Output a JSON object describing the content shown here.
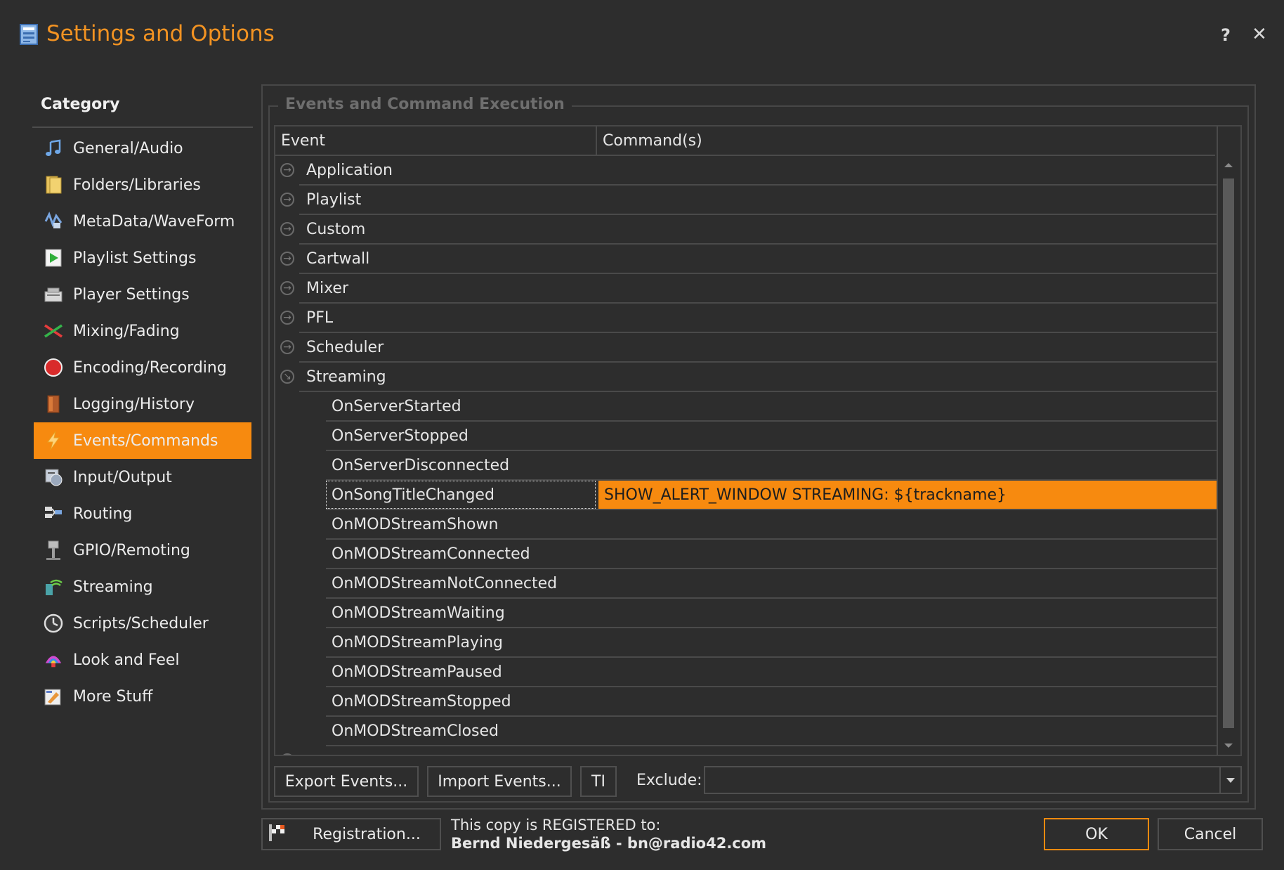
{
  "window": {
    "title": "Settings and Options",
    "help_label": "?",
    "close_label": "✕",
    "accent_color": "#f78a0f"
  },
  "sidebar": {
    "heading": "Category",
    "items": [
      {
        "label": "General/Audio",
        "icon": "music-note-icon"
      },
      {
        "label": "Folders/Libraries",
        "icon": "folders-icon"
      },
      {
        "label": "MetaData/WaveForm",
        "icon": "metadata-icon"
      },
      {
        "label": "Playlist Settings",
        "icon": "playlist-icon"
      },
      {
        "label": "Player Settings",
        "icon": "player-icon"
      },
      {
        "label": "Mixing/Fading",
        "icon": "mixing-icon"
      },
      {
        "label": "Encoding/Recording",
        "icon": "record-icon"
      },
      {
        "label": "Logging/History",
        "icon": "logging-icon"
      },
      {
        "label": "Events/Commands",
        "icon": "lightning-icon",
        "active": true
      },
      {
        "label": "Input/Output",
        "icon": "input-output-icon"
      },
      {
        "label": "Routing",
        "icon": "routing-icon"
      },
      {
        "label": "GPIO/Remoting",
        "icon": "gpio-icon"
      },
      {
        "label": "Streaming",
        "icon": "streaming-icon"
      },
      {
        "label": "Scripts/Scheduler",
        "icon": "clock-icon"
      },
      {
        "label": "Look and Feel",
        "icon": "palette-icon"
      },
      {
        "label": "More Stuff",
        "icon": "more-stuff-icon"
      }
    ]
  },
  "events": {
    "group_title": "Events and Command Execution",
    "columns": {
      "event": "Event",
      "commands": "Command(s)"
    },
    "groups": [
      "Application",
      "Playlist",
      "Custom",
      "Cartwall",
      "Mixer",
      "PFL",
      "Scheduler"
    ],
    "expanded_group": "Streaming",
    "children": [
      {
        "event": "OnServerStarted",
        "command": ""
      },
      {
        "event": "OnServerStopped",
        "command": ""
      },
      {
        "event": "OnServerDisconnected",
        "command": ""
      },
      {
        "event": "OnSongTitleChanged",
        "command": "SHOW_ALERT_WINDOW STREAMING: ${trackname}",
        "selected": true
      },
      {
        "event": "OnMODStreamShown",
        "command": ""
      },
      {
        "event": "OnMODStreamConnected",
        "command": ""
      },
      {
        "event": "OnMODStreamNotConnected",
        "command": ""
      },
      {
        "event": "OnMODStreamWaiting",
        "command": ""
      },
      {
        "event": "OnMODStreamPlaying",
        "command": ""
      },
      {
        "event": "OnMODStreamPaused",
        "command": ""
      },
      {
        "event": "OnMODStreamStopped",
        "command": ""
      },
      {
        "event": "OnMODStreamClosed",
        "command": ""
      }
    ]
  },
  "toolbar": {
    "export_label": "Export Events...",
    "import_label": "Import Events...",
    "ti_label": "TI",
    "exclude_label": "Exclude:",
    "exclude_value": ""
  },
  "footer": {
    "registration_label": "Registration...",
    "registered_line1": "This copy is REGISTERED to:",
    "registered_line2": "Bernd Niedergesäß - bn@radio42.com",
    "ok_label": "OK",
    "cancel_label": "Cancel"
  }
}
